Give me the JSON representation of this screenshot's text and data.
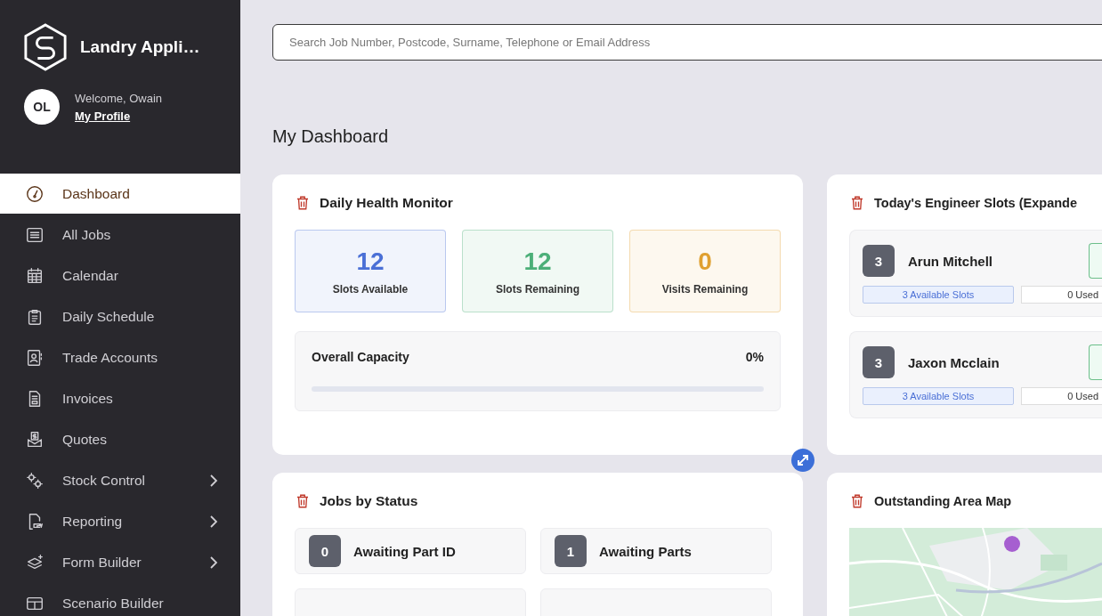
{
  "sidebar": {
    "app_name": "Landry Appli…",
    "avatar": "OL",
    "welcome": "Welcome, Owain",
    "profile_link": "My Profile",
    "items": [
      {
        "label": "Dashboard",
        "selected": true,
        "expandable": false
      },
      {
        "label": "All Jobs",
        "selected": false,
        "expandable": false
      },
      {
        "label": "Calendar",
        "selected": false,
        "expandable": false
      },
      {
        "label": "Daily Schedule",
        "selected": false,
        "expandable": false
      },
      {
        "label": "Trade Accounts",
        "selected": false,
        "expandable": false
      },
      {
        "label": "Invoices",
        "selected": false,
        "expandable": false
      },
      {
        "label": "Quotes",
        "selected": false,
        "expandable": false
      },
      {
        "label": "Stock Control",
        "selected": false,
        "expandable": true
      },
      {
        "label": "Reporting",
        "selected": false,
        "expandable": true
      },
      {
        "label": "Form Builder",
        "selected": false,
        "expandable": true
      },
      {
        "label": "Scenario Builder",
        "selected": false,
        "expandable": false
      }
    ]
  },
  "search": {
    "placeholder": "Search Job Number, Postcode, Surname, Telephone or Email Address"
  },
  "page_title": "My Dashboard",
  "health_monitor": {
    "title": "Daily Health Monitor",
    "stats": [
      {
        "value": "12",
        "label": "Slots Available",
        "color": "#4a6fd6"
      },
      {
        "value": "12",
        "label": "Slots Remaining",
        "color": "#4caf78"
      },
      {
        "value": "0",
        "label": "Visits Remaining",
        "color": "#e0a030"
      }
    ],
    "capacity": {
      "label": "Overall Capacity",
      "reading": "0%",
      "level": 0
    }
  },
  "engineer_slots": {
    "title": "Today's Engineer Slots (Expande",
    "engineers": [
      {
        "count": "3",
        "name": "Arun Mitchell",
        "available": "3 Available Slots",
        "used": "0 Used"
      },
      {
        "count": "3",
        "name": "Jaxon Mcclain",
        "available": "3 Available Slots",
        "used": "0 Used"
      }
    ]
  },
  "jobs_by_status": {
    "title": "Jobs by Status",
    "statuses": [
      {
        "count": "0",
        "label": "Awaiting Part ID"
      },
      {
        "count": "1",
        "label": "Awaiting Parts"
      }
    ]
  },
  "area_map": {
    "title": "Outstanding Area Map"
  }
}
